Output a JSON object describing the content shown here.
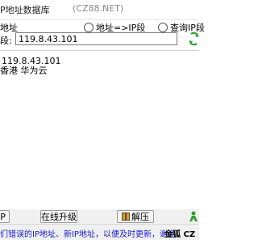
{
  "window": {
    "title": "P地址数据库",
    "subtitle": "(CZ88.NET)"
  },
  "mode_options": [
    {
      "label": "地址",
      "selected": false
    },
    {
      "label": "地址=>IP段",
      "selected": false
    },
    {
      "label": "查询IP段",
      "selected": false
    }
  ],
  "query": {
    "label": "段:",
    "ip_value": "119.8.43.101"
  },
  "result": {
    "ip": "119.8.43.101",
    "location": "香港 华为云"
  },
  "buttons": {
    "ip_label": "IP",
    "online_upgrade_label": "在线升级",
    "unzip_label": "解压"
  },
  "status": {
    "notice": "们错误的IP地址、新IP地址，以便及时更新，谢谢！",
    "brand": "金狐 CZ"
  },
  "colors": {
    "link_blue": "#1a1ad0",
    "accent_green": "#2ea02e"
  }
}
